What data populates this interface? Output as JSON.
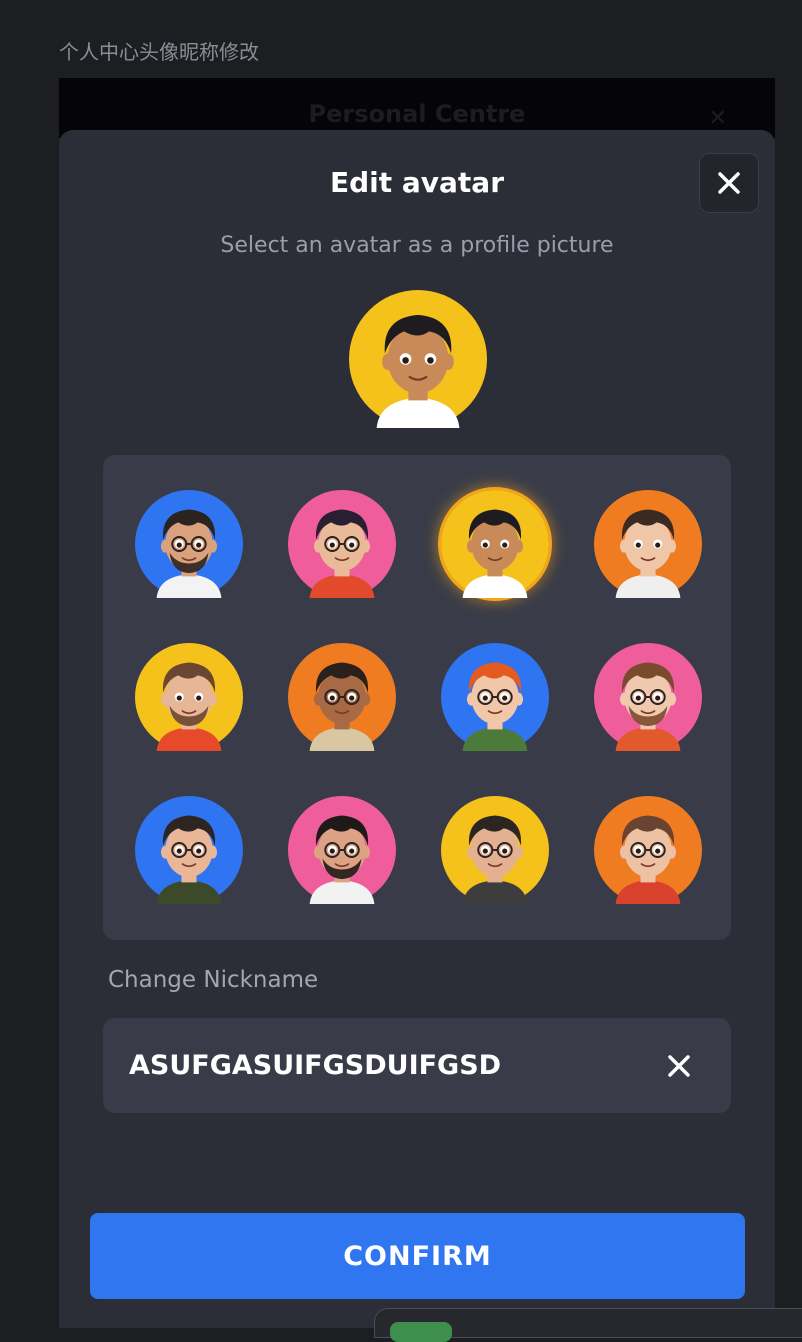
{
  "page_caption": "个人中心头像昵称修改",
  "underlay": {
    "title": "Personal Centre",
    "close_glyph": "✕"
  },
  "modal": {
    "title": "Edit avatar",
    "subtitle": "Select an avatar as a profile picture",
    "close_icon": "close-icon"
  },
  "current_avatar": {
    "bg": "#f5c21c",
    "skin": "#c98a5a",
    "hair": "#1e1c1e",
    "glasses": false,
    "beard": false,
    "shirt": "#ffffff"
  },
  "avatars": [
    {
      "bg": "#2f74f0",
      "skin": "#d9a27c",
      "hair": "#2b231f",
      "glasses": true,
      "beard": true,
      "shirt": "#f3f3f3"
    },
    {
      "bg": "#ef5d9b",
      "skin": "#e8ba98",
      "hair": "#2a1f32",
      "glasses": true,
      "beard": false,
      "shirt": "#e34a2c"
    },
    {
      "bg": "#f5c21c",
      "skin": "#c98a5a",
      "hair": "#1e1c1e",
      "glasses": false,
      "beard": false,
      "shirt": "#ffffff",
      "selected": true
    },
    {
      "bg": "#f07c22",
      "skin": "#f0c6a8",
      "hair": "#3a2a22",
      "glasses": false,
      "beard": false,
      "shirt": "#efefef"
    },
    {
      "bg": "#f5c21c",
      "skin": "#e6b697",
      "hair": "#6b4630",
      "glasses": false,
      "beard": true,
      "shirt": "#e64a2a"
    },
    {
      "bg": "#f07c22",
      "skin": "#a86a45",
      "hair": "#2a201c",
      "glasses": true,
      "beard": false,
      "shirt": "#d8c7a0"
    },
    {
      "bg": "#2f74f0",
      "skin": "#f2c6a8",
      "hair": "#e55a1f",
      "glasses": true,
      "beard": false,
      "shirt": "#4b7a3a"
    },
    {
      "bg": "#ef5d9b",
      "skin": "#f0c8ae",
      "hair": "#7a4a2c",
      "glasses": true,
      "beard": true,
      "shirt": "#e25a2c"
    },
    {
      "bg": "#2f74f0",
      "skin": "#e9b697",
      "hair": "#2d2522",
      "glasses": true,
      "beard": false,
      "shirt": "#3c4a2a"
    },
    {
      "bg": "#ef5d9b",
      "skin": "#dca283",
      "hair": "#1f1a18",
      "glasses": true,
      "beard": true,
      "shirt": "#f2f2f2"
    },
    {
      "bg": "#f5c21c",
      "skin": "#e4b092",
      "hair": "#2c2522",
      "glasses": true,
      "beard": false,
      "shirt": "#3d3d3d"
    },
    {
      "bg": "#f07c22",
      "skin": "#edc1a4",
      "hair": "#6a4331",
      "glasses": true,
      "beard": false,
      "shirt": "#d8412c"
    }
  ],
  "nickname": {
    "label": "Change Nickname",
    "value": "ASUFGASUIFGSDUIFGSD",
    "clear_icon": "clear-icon"
  },
  "confirm_label": "CONFIRM",
  "colors": {
    "accent": "#2f76f0",
    "selected_ring": "#f6a31c",
    "modal_bg": "#2b2e37",
    "panel_bg": "#393c48"
  }
}
